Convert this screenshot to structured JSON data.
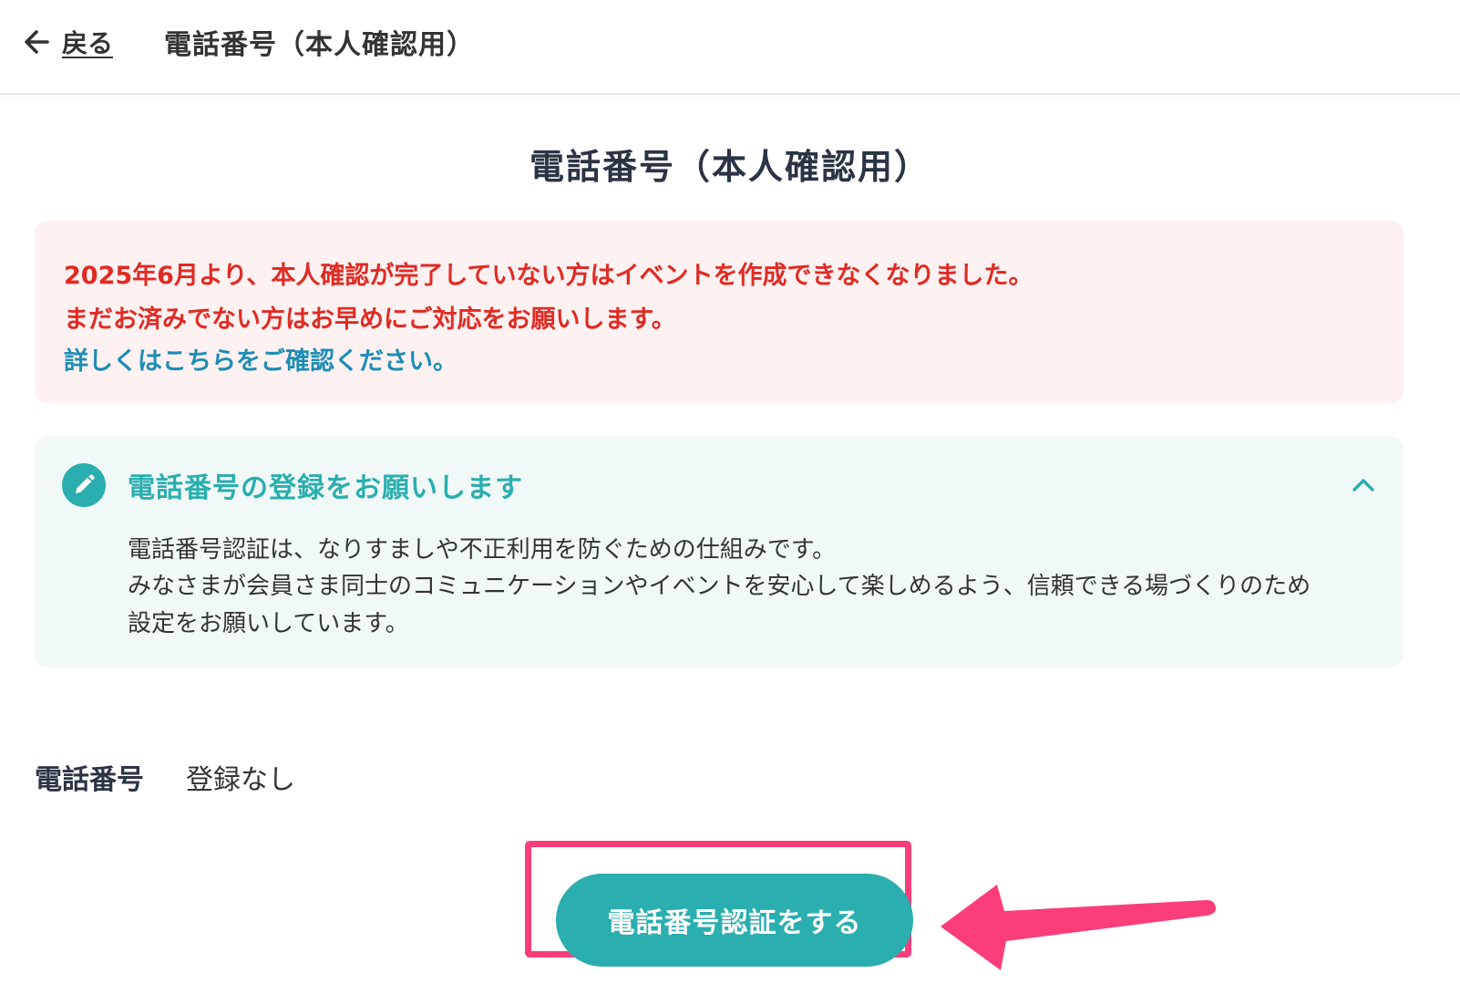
{
  "header": {
    "back_label": "戻る",
    "title": "電話番号（本人確認用）"
  },
  "page": {
    "title": "電話番号（本人確認用）"
  },
  "notice": {
    "line1": "2025年6月より、本人確認が完了していない方はイベントを作成できなくなりました。",
    "line2": "まだお済みでない方はお早めにご対応をお願いします。",
    "link_text": "詳しくはこちらをご確認ください。",
    "text_color": "#e02b24",
    "link_color": "#1d8db5",
    "background": "#fdf1f1"
  },
  "info_panel": {
    "heading": "電話番号の登録をお願いします",
    "body_line1": "電話番号認証は、なりすましや不正利用を防ぐための仕組みです。",
    "body_line2": "みなさまが会員さま同士のコミュニケーションやイベントを安心して楽しめるよう、信頼できる場づくりのため",
    "body_line3": "設定をお願いしています。",
    "accent_color": "#2aaeaf",
    "background": "#f0f9f8",
    "expanded": true,
    "icons": [
      "pencil-icon",
      "chevron-up-icon"
    ]
  },
  "phone_field": {
    "label": "電話番号",
    "value": "登録なし"
  },
  "actions": {
    "verify_button_label": "電話番号認証をする",
    "button_color": "#2aaeaf",
    "highlight_color": "#fb3d7a"
  }
}
